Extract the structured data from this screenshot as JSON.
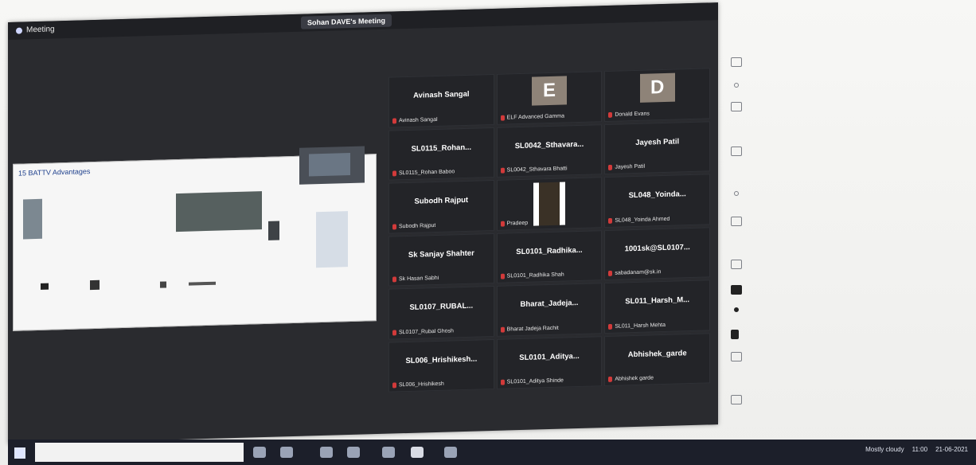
{
  "window": {
    "app_label": "Meeting",
    "title": "Sohan DAVE's Meeting"
  },
  "share": {
    "label": "15 BATTV Advantages"
  },
  "participants": [
    {
      "name": "Avinash Sangal",
      "label": "Avinash Sangal"
    },
    {
      "name": "",
      "label": "ELF Advanced Gamma",
      "avatar": "E"
    },
    {
      "name": "",
      "label": "Donald Evans",
      "avatar": "D"
    },
    {
      "name": "SL0115_Rohan...",
      "label": "SL0115_Rohan Baboo"
    },
    {
      "name": "SL0042_Sthavara...",
      "label": "SL0042_Sthavara Bhatti"
    },
    {
      "name": "Jayesh Patil",
      "label": "Jayesh Patil"
    },
    {
      "name": "Subodh Rajput",
      "label": "Subodh Rajput"
    },
    {
      "name": "",
      "label": "Pradeep",
      "video": true
    },
    {
      "name": "SL048_Yoinda...",
      "label": "SL048_Yoinda Ahmed"
    },
    {
      "name": "Sk Sanjay Shahter",
      "label": "Sk Hasan Sabhi"
    },
    {
      "name": "SL0101_Radhika...",
      "label": "SL0101_Radhika Shah"
    },
    {
      "name": "1001sk@SL0107...",
      "label": "sabadanam@sk.in"
    },
    {
      "name": "SL0107_RUBAL...",
      "label": "SL0107_Rubal Ghosh"
    },
    {
      "name": "Bharat_Jadeja...",
      "label": "Bharat Jadeja Rachit"
    },
    {
      "name": "SL011_Harsh_M...",
      "label": "SL011_Harsh Mehta"
    },
    {
      "name": "SL006_Hrishikesh...",
      "label": "SL006_Hrishikesh"
    },
    {
      "name": "SL0101_Aditya...",
      "label": "SL0101_Aditya Shinde"
    },
    {
      "name": "Abhishek_garde",
      "label": "Abhishek garde"
    }
  ],
  "taskbar": {
    "tray_status": "Mostly cloudy",
    "tray_time": "11:00",
    "tray_date": "21-06-2021"
  }
}
